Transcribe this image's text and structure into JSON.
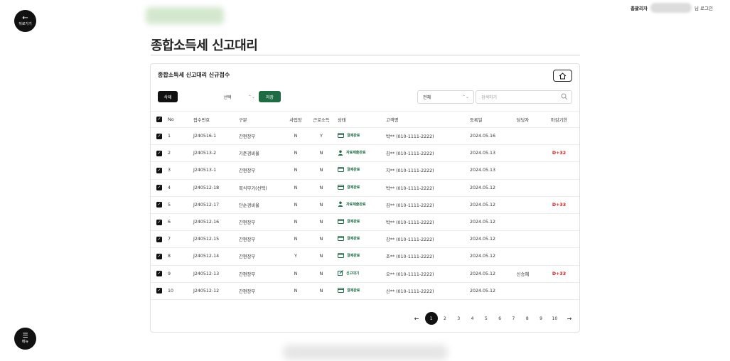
{
  "nav": {
    "back_label": "뒤로가기",
    "menu_label": "메뉴"
  },
  "header": {
    "role": "총괄리자",
    "login_text": "님 로그인"
  },
  "page_title": "종합소득세 신고대리",
  "card": {
    "title": "종합소득세 신고대리 신규접수",
    "delete_label": "삭제",
    "choose_label": "선택",
    "save_label": "저장",
    "filter_value": "전체",
    "search_placeholder": "검색하기"
  },
  "table": {
    "columns": [
      "No",
      "접수번호",
      "구분",
      "사업장",
      "근로소득",
      "상태",
      "고객명",
      "등록일",
      "담당자",
      "마감기한"
    ],
    "rows": [
      {
        "no": "1",
        "receipt": "J240516-1",
        "type": "간편장부",
        "business": "N",
        "labor": "Y",
        "status": "결제완료",
        "status_icon": "card-icon",
        "customer": "박** (010-1111-2222)",
        "date": "2024.05.16",
        "manager": "",
        "due": ""
      },
      {
        "no": "2",
        "receipt": "J240513-2",
        "type": "기준경비율",
        "business": "N",
        "labor": "N",
        "status": "자료제출완료",
        "status_icon": "person-icon",
        "customer": "김** (010-1111-2222)",
        "date": "2024.05.13",
        "manager": "",
        "due": "D+32"
      },
      {
        "no": "3",
        "receipt": "J240513-1",
        "type": "간편장부",
        "business": "N",
        "labor": "N",
        "status": "결제완료",
        "status_icon": "card-icon",
        "customer": "지** (010-1111-2222)",
        "date": "2024.05.13",
        "manager": "",
        "due": ""
      },
      {
        "no": "4",
        "receipt": "J240512-18",
        "type": "복식부기(선택)",
        "business": "N",
        "labor": "N",
        "status": "결제완료",
        "status_icon": "card-icon",
        "customer": "박** (010-1111-2222)",
        "date": "2024.05.12",
        "manager": "",
        "due": ""
      },
      {
        "no": "5",
        "receipt": "J240512-17",
        "type": "단순경비율",
        "business": "N",
        "labor": "N",
        "status": "자료제출완료",
        "status_icon": "person-icon",
        "customer": "김** (010-1111-2222)",
        "date": "2024.05.12",
        "manager": "",
        "due": "D+33"
      },
      {
        "no": "6",
        "receipt": "J240512-16",
        "type": "간편장부",
        "business": "N",
        "labor": "N",
        "status": "결제완료",
        "status_icon": "card-icon",
        "customer": "박** (010-1111-2222)",
        "date": "2024.05.12",
        "manager": "",
        "due": ""
      },
      {
        "no": "7",
        "receipt": "J240512-15",
        "type": "간편장부",
        "business": "N",
        "labor": "N",
        "status": "결제완료",
        "status_icon": "card-icon",
        "customer": "강** (010-1111-2222)",
        "date": "2024.05.12",
        "manager": "",
        "due": ""
      },
      {
        "no": "8",
        "receipt": "J240512-14",
        "type": "간편장부",
        "business": "Y",
        "labor": "N",
        "status": "결제완료",
        "status_icon": "card-icon",
        "customer": "조** (010-1111-2222)",
        "date": "2024.05.12",
        "manager": "",
        "due": ""
      },
      {
        "no": "9",
        "receipt": "J240512-13",
        "type": "간편장부",
        "business": "N",
        "labor": "N",
        "status": "신고대기",
        "status_icon": "edit-icon",
        "customer": "오** (010-1111-2222)",
        "date": "2024.05.12",
        "manager": "신승혜",
        "due": "D+33"
      },
      {
        "no": "10",
        "receipt": "J240512-12",
        "type": "간편장부",
        "business": "N",
        "labor": "N",
        "status": "결제완료",
        "status_icon": "card-icon",
        "customer": "신** (010-1111-2222)",
        "date": "2024.05.12",
        "manager": "",
        "due": ""
      }
    ]
  },
  "pagination": {
    "pages": [
      "1",
      "2",
      "3",
      "4",
      "5",
      "6",
      "7",
      "8",
      "9",
      "10"
    ],
    "current": "1"
  },
  "colors": {
    "accent_green": "#1f6b44",
    "due_red": "#e02020",
    "dark": "#111111"
  }
}
